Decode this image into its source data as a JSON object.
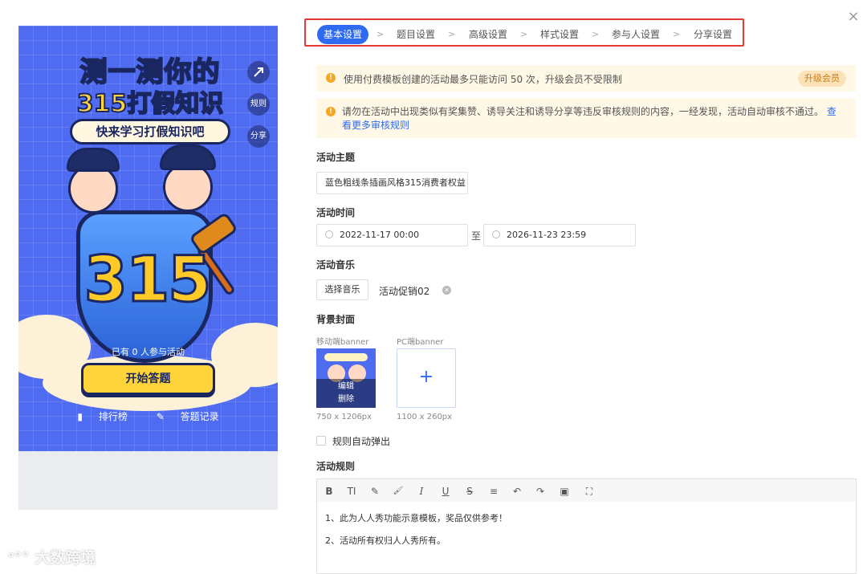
{
  "preview": {
    "headline_line1": "测一测你的",
    "headline_line2_num": "315",
    "headline_line2_text": "打假知识",
    "subtitle": "快来学习打假知识吧",
    "side_buttons": {
      "share_icon_label": "",
      "rules": "规则",
      "share": "分享"
    },
    "big_number": "315",
    "participants": "已有 0 人参与活动",
    "start_button": "开始答题",
    "leaderboard": "排行榜",
    "records": "答题记录"
  },
  "tabs": [
    {
      "label": "基本设置",
      "active": true
    },
    {
      "label": "题目设置"
    },
    {
      "label": "高级设置"
    },
    {
      "label": "样式设置"
    },
    {
      "label": "参与人设置"
    },
    {
      "label": "分享设置"
    }
  ],
  "tab_separator": ">",
  "notices": {
    "limit": "使用付费模板创建的活动最多只能访问 50 次，升级会员不受限制",
    "upgrade_button": "升级会员",
    "review_text": "请勿在活动中出现类似有奖集赞、诱导关注和诱导分享等违反审核规则的内容，一经发现，活动自动审核不通过。",
    "review_link_1": "查",
    "review_link_2": "看更多审核规则"
  },
  "form": {
    "theme_label": "活动主题",
    "theme_value": "蓝色粗线条插画风格315消费者权益",
    "time_label": "活动时间",
    "start_time": "2022-11-17 00:00",
    "to_text": "至",
    "end_time": "2026-11-23 23:59",
    "music_label": "活动音乐",
    "choose_music": "选择音乐",
    "music_name": "活动促销02",
    "cover_label": "背景封面",
    "mobile_banner_label": "移动端banner",
    "pc_banner_label": "PC端banner",
    "edit": "编辑",
    "delete": "删除",
    "mobile_size": "750 x 1206px",
    "pc_size": "1100 x 260px",
    "auto_popup": "规则自动弹出",
    "rules_label": "活动规则",
    "rules_line1": "1、此为人人秀功能示意模板，奖品仅供参考！",
    "rules_line2": "2、活动所有权归人人秀所有。"
  },
  "toolbar": [
    "B",
    "TI",
    "✎",
    "🖌",
    "I",
    "U",
    "S",
    "≡",
    "↶",
    "↷",
    "▣",
    "⛶"
  ],
  "watermark": "大数跨境",
  "close": "×"
}
